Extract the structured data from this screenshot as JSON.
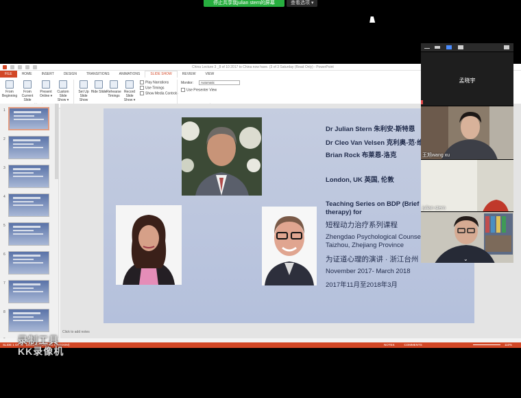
{
  "zoom": {
    "stop_share_label": "停止共享我julian  stern的屏幕",
    "view_options_label": "查看选项",
    "view_options_chevron": "chevron-down-icon",
    "participants": [
      {
        "name": "孟晓宇",
        "video": false
      },
      {
        "name": "王旭wang xu",
        "video": true
      },
      {
        "name": "julian stern",
        "video": true
      },
      {
        "name": "",
        "video": true
      }
    ]
  },
  "ppt": {
    "doc_title": "China Lecture 3 _8 of 10 2017 to China now have. (3 of 3 Saturday (Read Only) - PowerPoint",
    "tabs": [
      "FILE",
      "HOME",
      "INSERT",
      "DESIGN",
      "TRANSITIONS",
      "ANIMATIONS",
      "SLIDE SHOW",
      "REVIEW",
      "VIEW"
    ],
    "active_tab": "SLIDE SHOW",
    "ribbon": {
      "buttons": [
        {
          "label": "From Beginning",
          "icon": "play-from-start-icon"
        },
        {
          "label": "From Current Slide",
          "icon": "play-current-icon"
        },
        {
          "label": "Present Online ▾",
          "icon": "present-online-icon"
        },
        {
          "label": "Custom Slide Show ▾",
          "icon": "custom-show-icon"
        },
        {
          "label": "Set Up Slide Show",
          "icon": "setup-show-icon"
        },
        {
          "label": "Hide Slide",
          "icon": "hide-slide-icon"
        },
        {
          "label": "Rehearse Timings",
          "icon": "rehearse-icon"
        },
        {
          "label": "Record Slide Show ▾",
          "icon": "record-icon"
        }
      ],
      "checks": [
        "Play Narrations",
        "Use Timings",
        "Show Media Controls"
      ],
      "monitor_label": "Monitor:",
      "monitor_value": "Automatic",
      "presenter_view_label": "Use Presenter View",
      "groups": [
        "Start Slide Show",
        "Set Up",
        "Monitors"
      ]
    },
    "thumbnails": [
      "1",
      "2",
      "3",
      "4",
      "5",
      "6",
      "7",
      "8",
      "9"
    ],
    "selected_slide": 1,
    "notes_placeholder": "Click to add notes",
    "status": {
      "slide_indicator": "SLIDE 1 OF 11",
      "language": "ENGLISH (UNITED KINGDOM)",
      "notes": "NOTES",
      "comments": "COMMENTS",
      "zoom": "110%"
    }
  },
  "slide": {
    "name1": "Dr Julian Stern 朱利安-斯特恩",
    "name2": "Dr Cleo Van Velsen 克利奥-范·维尔森",
    "name3": "Brian Rock 布莱恩-洛克",
    "location": "London, UK 英国,   伦敦",
    "series_title_1": "Teaching Series on BDP (Brief Dynamic",
    "series_title_2": "therapy) for",
    "series_title_cn": "短程动力治疗系列课程",
    "org_1": "Zhengdao Psychological Counseling",
    "org_2": "Taizhou, Zhejiang Province",
    "org_cn": "为证道心理的演讲 · 浙江台州",
    "dates_en": "November 2017- March 2018",
    "dates_cn": "2017年11月至2018年3月"
  },
  "watermark": {
    "line1": "录制工具",
    "line2": "KK录像机"
  },
  "colors": {
    "ppt_accent": "#d24726",
    "share_green": "#27ae3f",
    "slide_text": "#1f2a4a"
  }
}
